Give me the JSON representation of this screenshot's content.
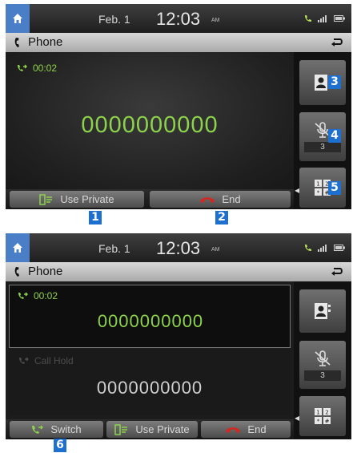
{
  "status": {
    "date": "Feb.  1",
    "time": "12:03",
    "ampm": "AM"
  },
  "title": {
    "text": "Phone"
  },
  "screen1": {
    "timer": "00:02",
    "number": "0000000000",
    "buttons": {
      "use_private": "Use Private",
      "end": "End"
    },
    "side": {
      "mic_level": "3"
    }
  },
  "screen2": {
    "active": {
      "timer": "00:02",
      "number": "0000000000"
    },
    "hold": {
      "label": "Call Hold",
      "number": "0000000000"
    },
    "buttons": {
      "switch": "Switch",
      "use_private": "Use Private",
      "end": "End"
    },
    "side": {
      "mic_level": "3"
    }
  },
  "callouts": [
    "1",
    "2",
    "3",
    "4",
    "5",
    "6"
  ],
  "colors": {
    "accent_green": "#8cd24a",
    "callout_blue": "#1d6fd0",
    "end_red": "#d7261e",
    "home_blue": "#4a7fc8"
  }
}
